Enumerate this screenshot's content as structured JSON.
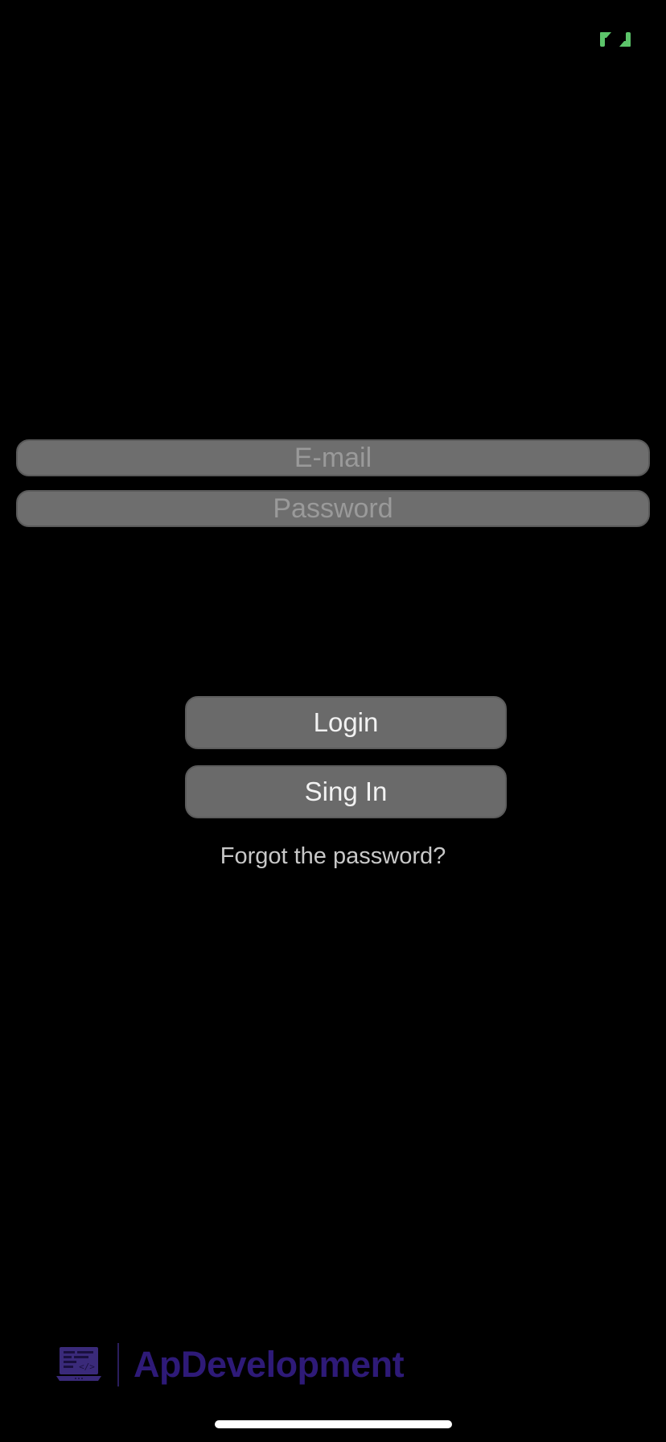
{
  "colors": {
    "background": "#000000",
    "field_background": "#6e6e6e",
    "button_background": "#6a6a6a",
    "brand_accent": "#2e1a78",
    "expand_icon": "#5cc46a"
  },
  "icons": {
    "expand": "expand-icon",
    "brand_logo": "laptop-code-icon"
  },
  "form": {
    "email_placeholder": "E-mail",
    "password_placeholder": "Password"
  },
  "actions": {
    "login_label": "Login",
    "signin_label": "Sing In",
    "forgot_label": "Forgot the password?"
  },
  "footer": {
    "brand_name": "ApDevelopment"
  }
}
